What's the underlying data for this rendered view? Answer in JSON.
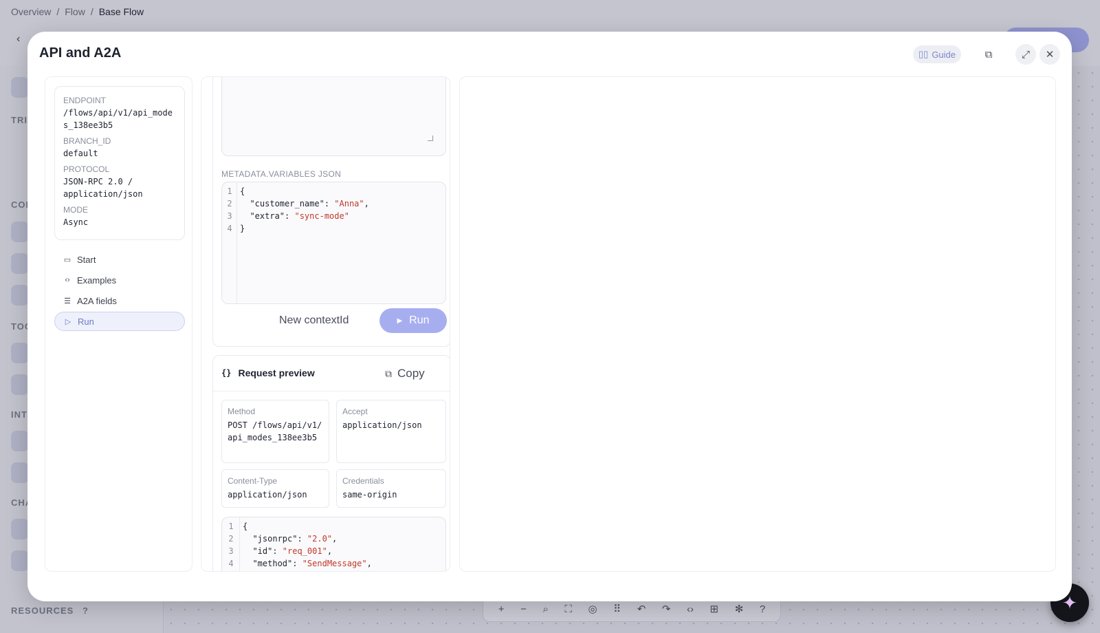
{
  "breadcrumb": {
    "items": [
      "Overview",
      "Flow"
    ],
    "current": "Base Flow",
    "separator": "/"
  },
  "background": {
    "sidebar_sections": [
      "TRIG",
      "COR",
      "TOO",
      "INTE",
      "CHA"
    ],
    "resources_label": "RESOURCES",
    "resources_help": "?"
  },
  "modal": {
    "title": "API and A2A",
    "guide_label": "Guide"
  },
  "info": {
    "endpoint_label": "ENDPOINT",
    "endpoint_value": "/flows/api/v1/api_modes_138ee3b5",
    "branch_label": "BRANCH_ID",
    "branch_value": "default",
    "protocol_label": "PROTOCOL",
    "protocol_value": "JSON-RPC 2.0 / application/json",
    "mode_label": "MODE",
    "mode_value": "Async"
  },
  "nav": {
    "items": [
      {
        "label": "Start",
        "icon": "book-icon"
      },
      {
        "label": "Examples",
        "icon": "code-icon"
      },
      {
        "label": "A2A fields",
        "icon": "list-icon"
      },
      {
        "label": "Run",
        "icon": "play-icon",
        "active": true
      }
    ]
  },
  "run": {
    "metadata_label": "METADATA.VARIABLES JSON",
    "metadata_lines": [
      {
        "n": "1",
        "pre": "{",
        "key": "",
        "str": "",
        "post": ""
      },
      {
        "n": "2",
        "pre": "  \"customer_name\": ",
        "str": "\"Anna\"",
        "post": ","
      },
      {
        "n": "3",
        "pre": "  \"extra\": ",
        "str": "\"sync-mode\"",
        "post": ""
      },
      {
        "n": "4",
        "pre": "}",
        "str": "",
        "post": ""
      }
    ],
    "new_context_label": "New contextId",
    "run_label": "Run"
  },
  "preview": {
    "title": "Request preview",
    "title_icon": "{}",
    "copy_label": "Copy",
    "method_label": "Method",
    "method_value": "POST /flows/api/v1/api_modes_138ee3b5",
    "accept_label": "Accept",
    "accept_value": "application/json",
    "content_type_label": "Content-Type",
    "content_type_value": "application/json",
    "credentials_label": "Credentials",
    "credentials_value": "same-origin",
    "body_lines": [
      {
        "n": "1",
        "pre": "{",
        "str": "",
        "post": ""
      },
      {
        "n": "2",
        "pre": "  \"jsonrpc\": ",
        "str": "\"2.0\"",
        "post": ","
      },
      {
        "n": "3",
        "pre": "  \"id\": ",
        "str": "\"req_001\"",
        "post": ","
      },
      {
        "n": "4",
        "pre": "  \"method\": ",
        "str": "\"SendMessage\"",
        "post": ","
      }
    ]
  },
  "colors": {
    "accent": "#a7aef0",
    "string": "#c0392b",
    "active_nav": "#6f79c4"
  }
}
